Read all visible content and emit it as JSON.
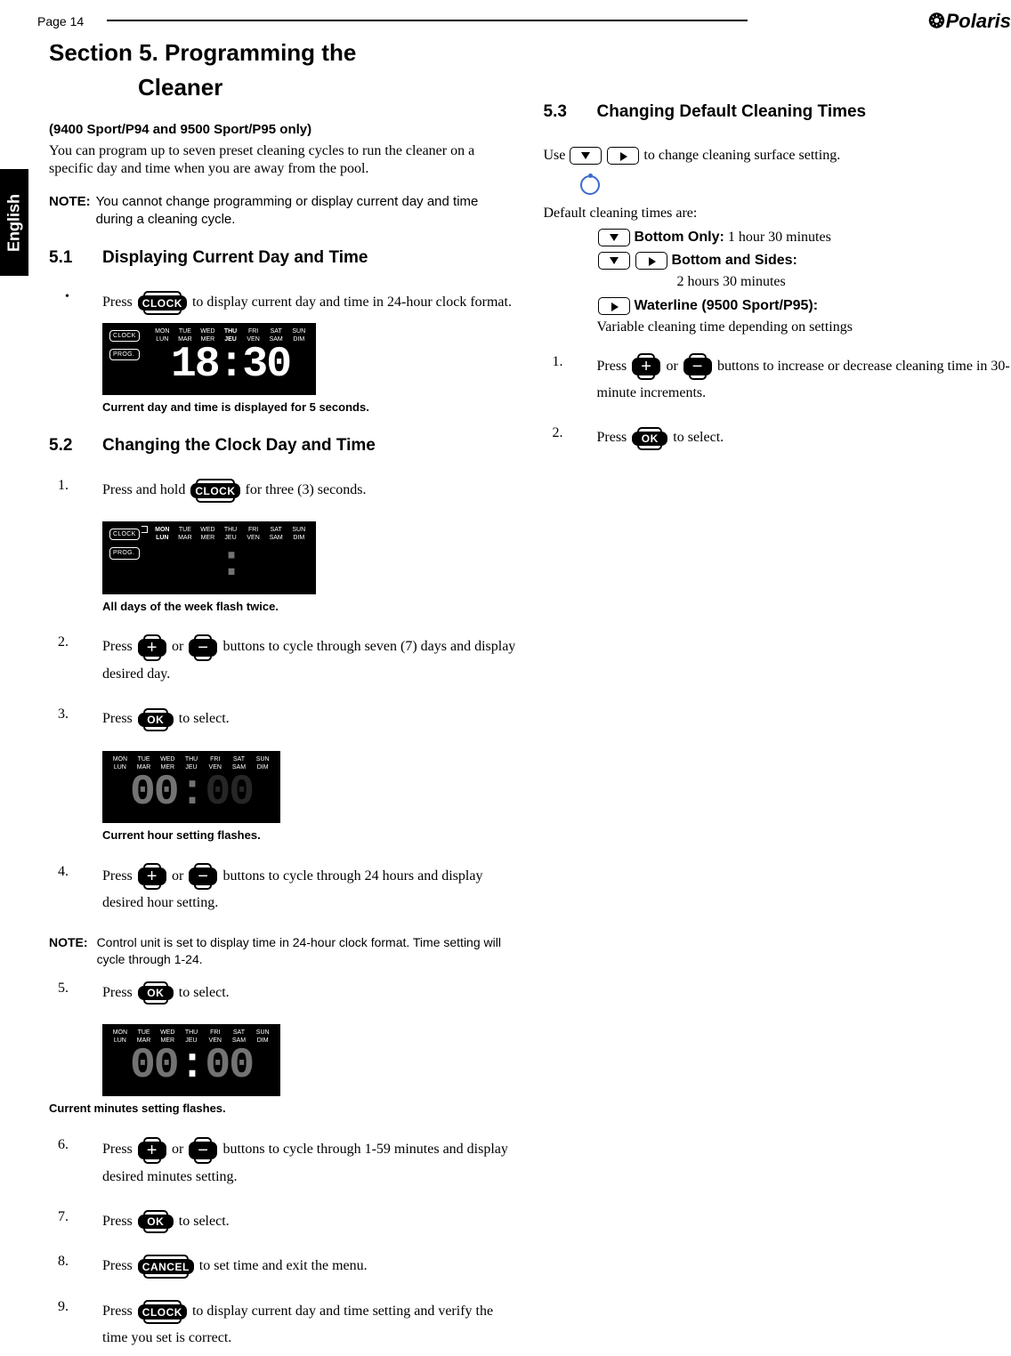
{
  "page_number": "Page 14",
  "logo": "Polaris",
  "language_tab": "English",
  "section_title_l1": "Section 5. Programming the",
  "section_title_l2": "Cleaner",
  "models": "(9400 Sport/P94 and 9500 Sport/P95 only)",
  "intro": "You can program up to seven preset cleaning cycles to run the cleaner on a specific day and time when you are away from the pool.",
  "note1_label": "NOTE:",
  "note1_body": "You cannot change programming or display current day and time during a cleaning cycle.",
  "h_5_1_num": "5.1",
  "h_5_1": "Displaying Current Day and Time",
  "s51_bullet_a": "Press ",
  "s51_bullet_b": " to display current day and time in 24-hour clock format.",
  "disp1_time": "18:30",
  "caption1": "Current day and time is displayed for 5 seconds.",
  "h_5_2_num": "5.2",
  "h_5_2": "Changing the Clock Day and Time",
  "s52_1a": "Press and hold ",
  "s52_1b": " for three (3) seconds.",
  "caption2": "All days of the week flash twice.",
  "s52_2a": "Press ",
  "s52_2_or": " or ",
  "s52_2b": " buttons to cycle through seven (7) days and display desired day.",
  "s52_3a": "Press ",
  "s52_3b": " to select.",
  "disp3_time": "00:",
  "caption3": "Current hour setting flashes.",
  "s52_4a": "Press ",
  "s52_4b": " buttons to cycle through 24 hours and display desired hour setting.",
  "note2_label": "NOTE:",
  "note2_body": "Control unit is set to display time in 24-hour clock format. Time setting will cycle through 1-24.",
  "s52_5a": "Press ",
  "s52_5b": " to select.",
  "disp5_time": "00:00",
  "caption5": "Current minutes setting flashes.",
  "s52_6a": "Press ",
  "s52_6b": " buttons to cycle through 1-59 minutes and display desired minutes setting.",
  "s52_7a": "Press ",
  "s52_7b": " to select.",
  "s52_8a": "Press ",
  "s52_8b": "  to set time and exit the menu.",
  "s52_9a": "Press ",
  "s52_9b": " to display current day and time setting and verify the time you set is correct.",
  "h_5_3_num": "5.3",
  "h_5_3": "Changing Default Cleaning Times",
  "s53_use_a": "Use  ",
  "s53_use_b": "  to change cleaning surface setting.",
  "defaults_intro": "Default cleaning times are:",
  "def_bottom_only_lbl": "Bottom Only:",
  "def_bottom_only_val": "  1 hour 30 minutes",
  "def_both_lbl": " Bottom and Sides:",
  "def_both_val": "2 hours 30 minutes",
  "def_waterline_lbl": " Waterline (9500 Sport/P95):",
  "def_waterline_val": "Variable cleaning time depending on settings",
  "s53_1a": "Press ",
  "s53_1b": " buttons to increase or decrease cleaning time in 30-minute increments.",
  "s53_2a": "Press ",
  "s53_2b": " to select.",
  "btn_clock": "CLOCK",
  "btn_ok": "OK",
  "btn_cancel": "CANCEL",
  "btn_prog": "PROG.",
  "days_en": [
    "MON",
    "TUE",
    "WED",
    "THU",
    "FRI",
    "SAT",
    "SUN"
  ],
  "days_fr": [
    "LUN",
    "MAR",
    "MER",
    "JEU",
    "VEN",
    "SAM",
    "DIM"
  ]
}
